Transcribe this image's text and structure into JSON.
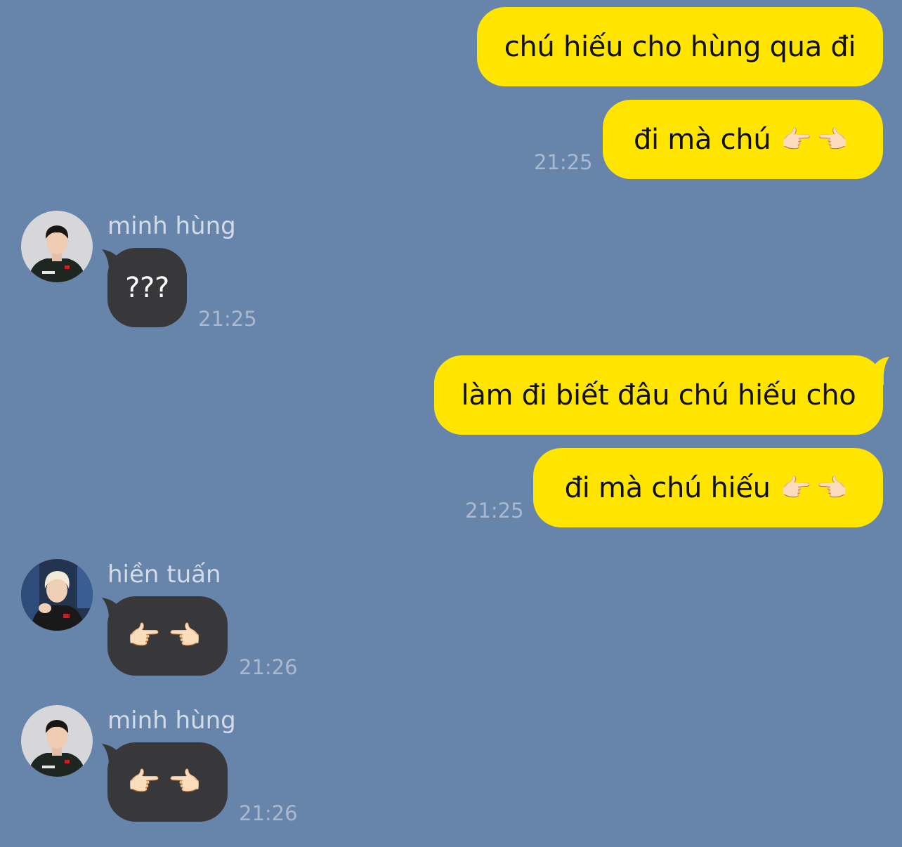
{
  "colors": {
    "background": "#6784ab",
    "outgoing_bubble": "#ffe500",
    "incoming_bubble": "#38383a",
    "timestamp": "#aab9d0",
    "sender_name": "#d3dbe8"
  },
  "messages": [
    {
      "direction": "out",
      "text": "chú hiếu cho hùng qua đi"
    },
    {
      "direction": "out",
      "text": "đi mà chú",
      "emoji": "👉🏻👈🏻",
      "time": "21:25"
    },
    {
      "direction": "in",
      "sender": "minh hùng",
      "avatar_icon": "profile-photo-icon",
      "text": "???",
      "time": "21:25"
    },
    {
      "direction": "out",
      "text": "làm đi biết đâu chú hiếu cho"
    },
    {
      "direction": "out",
      "text": "đi mà chú hiếu",
      "emoji": "👉🏻👈🏻",
      "time": "21:25"
    },
    {
      "direction": "in",
      "sender": "hiền tuấn",
      "avatar_icon": "profile-photo-icon",
      "emoji": "👉🏻👈🏻",
      "time": "21:26"
    },
    {
      "direction": "in",
      "sender": "minh hùng",
      "avatar_icon": "profile-photo-icon",
      "emoji": "👉🏻👈🏻",
      "time": "21:26"
    }
  ]
}
